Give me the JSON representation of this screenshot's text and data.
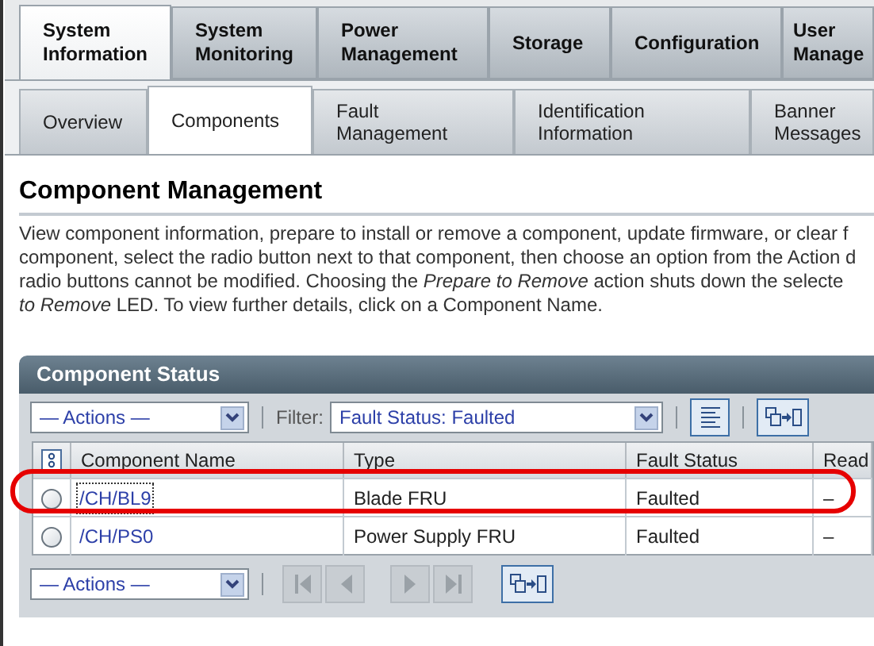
{
  "main_tabs": [
    {
      "label": "System Information",
      "selected": true
    },
    {
      "label": "System Monitoring",
      "selected": false
    },
    {
      "label": "Power Management",
      "selected": false
    },
    {
      "label": "Storage",
      "selected": false
    },
    {
      "label": "Configuration",
      "selected": false
    },
    {
      "label": "User Manage",
      "selected": false
    }
  ],
  "sub_tabs": [
    {
      "label": "Overview",
      "selected": false
    },
    {
      "label": "Components",
      "selected": true
    },
    {
      "label": "Fault Management",
      "selected": false
    },
    {
      "label": "Identification Information",
      "selected": false
    },
    {
      "label": "Banner Messages",
      "selected": false
    }
  ],
  "page_title": "Component Management",
  "description_lines": [
    "View component information, prepare to install or remove a component, update firmware, or clear f",
    "component, select the radio button next to that component, then choose an option from the Action d",
    "radio buttons cannot be modified. Choosing the *Prepare to Remove* action shuts down the selecte",
    "*to Remove* LED. To view further details, click on a Component Name."
  ],
  "table": {
    "title": "Component Status",
    "top_toolbar": {
      "actions": "— Actions —",
      "filter_label": "Filter:",
      "filter_value": "Fault Status: Faulted"
    },
    "columns": [
      "Component Name",
      "Type",
      "Fault Status",
      "Read"
    ],
    "rows": [
      {
        "selected": false,
        "name": "/CH/BL9",
        "type": "Blade FRU",
        "fault_status": "Faulted",
        "column_4": "–",
        "focused": true
      },
      {
        "selected": false,
        "name": "/CH/PS0",
        "type": "Power Supply FRU",
        "fault_status": "Faulted",
        "column_4": "–",
        "focused": false
      }
    ],
    "bottom_toolbar": {
      "actions": "— Actions —",
      "pagination_disabled": true
    }
  }
}
